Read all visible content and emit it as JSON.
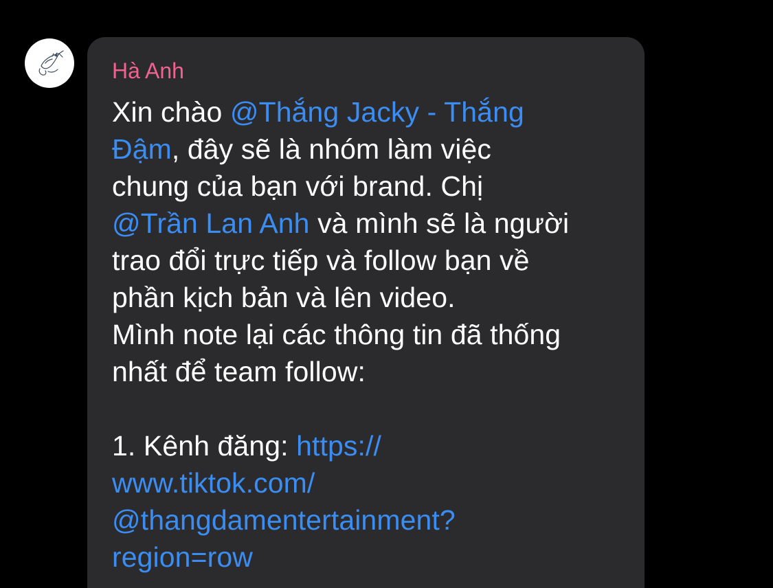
{
  "sender": {
    "name": "Hà Anh",
    "avatar_icon": "fish-sketch-icon",
    "name_color": "#f0628f"
  },
  "colors": {
    "background": "#000000",
    "bubble": "#2b2b2d",
    "text": "#ffffff",
    "link": "#3b8df2"
  },
  "message": {
    "greeting": "Xin chào ",
    "mention_1_part1": "@Thắng Jacky - Thắng",
    "mention_1_part2": "Đậm",
    "line2_rest": ", đây sẽ là nhóm làm việc",
    "line3": "chung của bạn với brand. Chị",
    "mention_2": "@Trần Lan Anh",
    "line4_rest": " và mình sẽ là người",
    "line5": "trao đổi trực tiếp và follow bạn về",
    "line6": "phần kịch bản và lên video.",
    "line7": "Mình note lại các thông tin đã thống",
    "line8": "nhất để team follow:",
    "item1_label": "1. Kênh đăng: ",
    "item1_link_part1": "https://",
    "item1_link_part2": "www.tiktok.com/",
    "item1_link_part3": "@thangdamentertainment?",
    "item1_link_part4": "region=row"
  }
}
